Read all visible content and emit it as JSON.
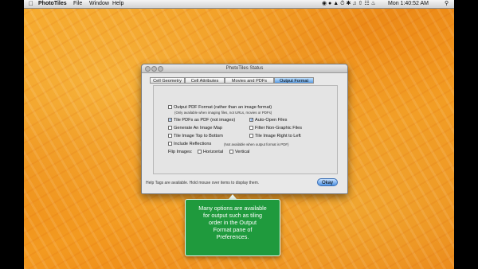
{
  "menubar": {
    "app_name": "PhotoTiles",
    "menus": [
      "File",
      "Window",
      "Help"
    ],
    "clock": "Mon 1:40:52 AM"
  },
  "window": {
    "title": "PhotoTiles Status",
    "tabs": [
      {
        "label": "Cell Geometry",
        "selected": false
      },
      {
        "label": "Cell Attributes",
        "selected": false
      },
      {
        "label": "Movies and PDFs",
        "selected": false
      },
      {
        "label": "Output Format",
        "selected": true
      }
    ],
    "options": {
      "output_pdf": {
        "label": "Output PDF Format (rather than an image format)",
        "checked": false,
        "note": "(Only available when imaging files, not URLs, movies or PDFs)"
      },
      "tile_pdfs": {
        "label": "Tile PDFs as PDF (not images)",
        "checked": true
      },
      "auto_open": {
        "label": "Auto-Open Files",
        "checked": true
      },
      "image_map": {
        "label": "Generate An Image Map",
        "checked": false
      },
      "filter_non_graphic": {
        "label": "Filter Non-Graphic Files",
        "checked": false
      },
      "top_to_bottom": {
        "label": "Tile Image Top to Bottom",
        "checked": false
      },
      "right_to_left": {
        "label": "Tile Image Right to Left",
        "checked": false
      },
      "reflections": {
        "label": "Include Reflections",
        "checked": false,
        "note": "(Not available when output format is PDF)"
      }
    },
    "flip": {
      "label": "Flip Images:",
      "horizontal": {
        "label": "Horizontal",
        "checked": false
      },
      "vertical": {
        "label": "Vertical",
        "checked": false
      }
    },
    "help_text": "Help Tags are available. Hold mouse over items to display them.",
    "ok_label": "Okay"
  },
  "callout": {
    "lines": [
      "Many options are available",
      "for output such as tiling",
      "order in the Output",
      "Format pane of",
      "Preferences."
    ]
  },
  "colors": {
    "callout_bg": "#1f9a3d",
    "selected_tab": "#5d9fe6",
    "desktop_orange": "#f39a20"
  }
}
